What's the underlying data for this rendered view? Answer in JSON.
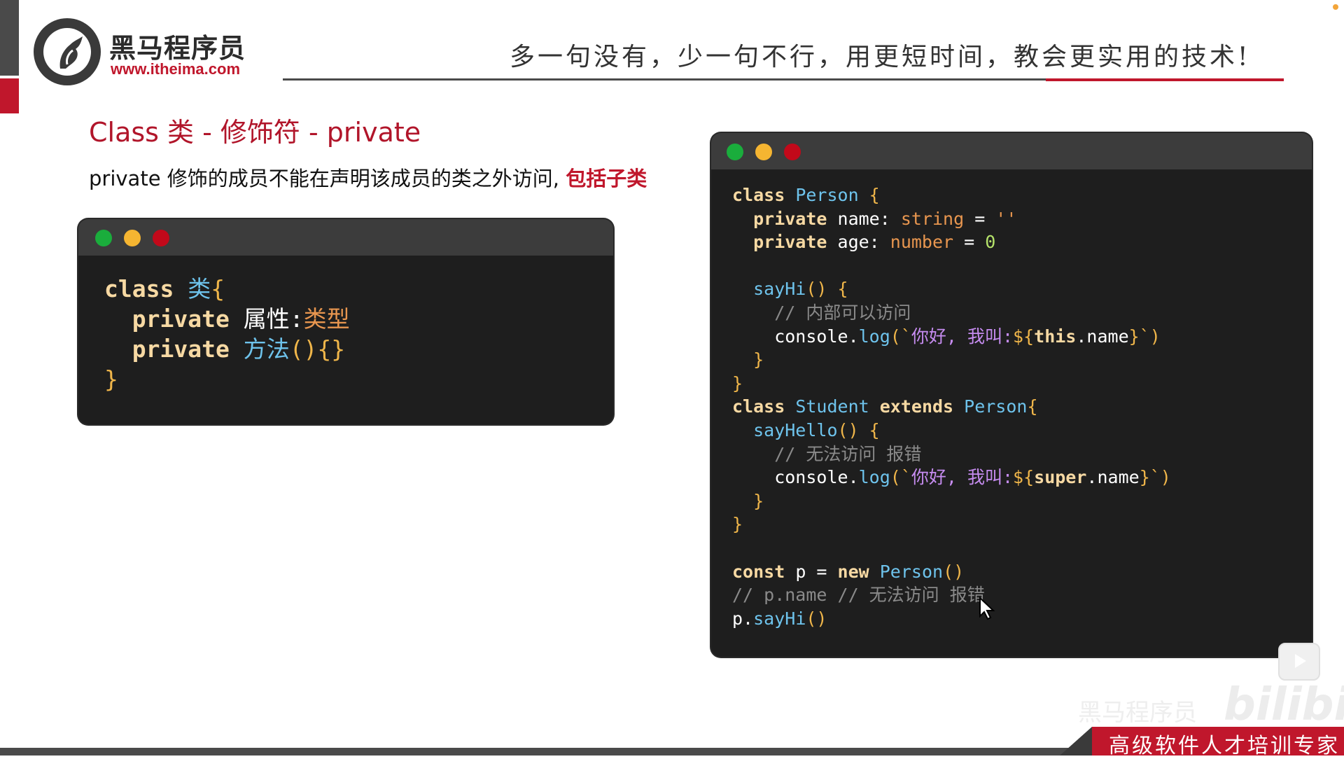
{
  "header": {
    "logo_cn": "黑马程序员",
    "logo_url": "www.itheima.com",
    "slogan": "多一句没有，少一句不行，用更短时间，教会更实用的技术!"
  },
  "slide": {
    "title": "Class 类 - 修饰符 - private",
    "desc_main": "private 修饰的成员不能在声明该成员的类之外访问, ",
    "desc_highlight": "包括子类"
  },
  "syntax_window": {
    "lines": [
      [
        {
          "t": "class ",
          "c": "kw"
        },
        {
          "t": "类",
          "c": "cls"
        },
        {
          "t": "{",
          "c": "brace"
        }
      ],
      [
        {
          "t": "  private ",
          "c": "kw"
        },
        {
          "t": "属性",
          "c": "white"
        },
        {
          "t": ":",
          "c": "white"
        },
        {
          "t": "类型",
          "c": "type"
        }
      ],
      [
        {
          "t": "  private ",
          "c": "kw"
        },
        {
          "t": "方法",
          "c": "fn"
        },
        {
          "t": "(){}",
          "c": "brace"
        }
      ],
      [
        {
          "t": "}",
          "c": "brace"
        }
      ]
    ]
  },
  "example_window": {
    "lines": [
      [
        {
          "t": "class ",
          "c": "kw"
        },
        {
          "t": "Person ",
          "c": "cls"
        },
        {
          "t": "{",
          "c": "brace"
        }
      ],
      [
        {
          "t": "  private ",
          "c": "kw"
        },
        {
          "t": "name: ",
          "c": "white"
        },
        {
          "t": "string ",
          "c": "type"
        },
        {
          "t": "= ",
          "c": "white"
        },
        {
          "t": "''",
          "c": "str"
        }
      ],
      [
        {
          "t": "  private ",
          "c": "kw"
        },
        {
          "t": "age: ",
          "c": "white"
        },
        {
          "t": "number ",
          "c": "type"
        },
        {
          "t": "= ",
          "c": "white"
        },
        {
          "t": "0",
          "c": "num"
        }
      ],
      [
        {
          "t": "",
          "c": "white"
        }
      ],
      [
        {
          "t": "  sayHi",
          "c": "fn"
        },
        {
          "t": "() {",
          "c": "brace"
        }
      ],
      [
        {
          "t": "    // 内部可以访问",
          "c": "comment"
        }
      ],
      [
        {
          "t": "    console.",
          "c": "white"
        },
        {
          "t": "log",
          "c": "fn"
        },
        {
          "t": "(`",
          "c": "brace"
        },
        {
          "t": "你好, 我叫:",
          "c": "tpl"
        },
        {
          "t": "${",
          "c": "tplexpr"
        },
        {
          "t": "this",
          "c": "kw"
        },
        {
          "t": ".name",
          "c": "white"
        },
        {
          "t": "}",
          "c": "tplexpr"
        },
        {
          "t": "`)",
          "c": "brace"
        }
      ],
      [
        {
          "t": "  }",
          "c": "brace"
        }
      ],
      [
        {
          "t": "}",
          "c": "brace"
        }
      ],
      [
        {
          "t": "class ",
          "c": "kw"
        },
        {
          "t": "Student ",
          "c": "cls"
        },
        {
          "t": "extends ",
          "c": "kw"
        },
        {
          "t": "Person",
          "c": "cls"
        },
        {
          "t": "{",
          "c": "brace"
        }
      ],
      [
        {
          "t": "  sayHello",
          "c": "fn"
        },
        {
          "t": "() {",
          "c": "brace"
        }
      ],
      [
        {
          "t": "    // 无法访问 报错",
          "c": "comment"
        }
      ],
      [
        {
          "t": "    console.",
          "c": "white"
        },
        {
          "t": "log",
          "c": "fn"
        },
        {
          "t": "(`",
          "c": "brace"
        },
        {
          "t": "你好, 我叫:",
          "c": "tpl"
        },
        {
          "t": "${",
          "c": "tplexpr"
        },
        {
          "t": "super",
          "c": "kw"
        },
        {
          "t": ".name",
          "c": "white"
        },
        {
          "t": "}",
          "c": "tplexpr"
        },
        {
          "t": "`)",
          "c": "brace"
        }
      ],
      [
        {
          "t": "  }",
          "c": "brace"
        }
      ],
      [
        {
          "t": "}",
          "c": "brace"
        }
      ],
      [
        {
          "t": "",
          "c": "white"
        }
      ],
      [
        {
          "t": "const ",
          "c": "kw"
        },
        {
          "t": "p ",
          "c": "white"
        },
        {
          "t": "= ",
          "c": "white"
        },
        {
          "t": "new ",
          "c": "kw"
        },
        {
          "t": "Person",
          "c": "cls"
        },
        {
          "t": "()",
          "c": "brace"
        }
      ],
      [
        {
          "t": "// p.name // 无法访问 报错",
          "c": "comment"
        }
      ],
      [
        {
          "t": "p.",
          "c": "white"
        },
        {
          "t": "sayHi",
          "c": "fn"
        },
        {
          "t": "()",
          "c": "brace"
        }
      ]
    ]
  },
  "watermark": {
    "text": "黑马程序员",
    "brand": "bilibili"
  },
  "footer": {
    "tagline": "高级软件人才培训专家"
  },
  "colors": {
    "brand_red": "#c0172c",
    "code_bg": "#1e1e1e",
    "titlebar_bg": "#3c3c3c"
  }
}
